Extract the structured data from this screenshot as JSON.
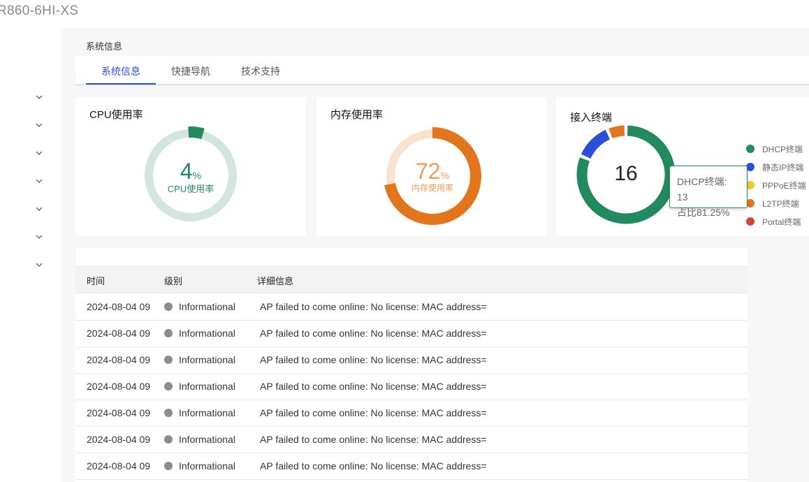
{
  "header": {
    "title": "R860-6HI-XS"
  },
  "sidebar": {
    "collapsed_items": 7
  },
  "breadcrumb": "系统信息",
  "tabs": [
    {
      "label": "系统信息",
      "active": true
    },
    {
      "label": "快捷导航"
    },
    {
      "label": "技术支持"
    }
  ],
  "cpu": {
    "title": "CPU使用率",
    "value": "4",
    "unit": "%",
    "label": "CPU使用率",
    "percent": 4,
    "color": "#23895e",
    "track": "#d3e6dd"
  },
  "memory": {
    "title": "内存使用率",
    "value": "72",
    "unit": "%",
    "label": "内存使用率",
    "percent": 72,
    "color": "#e3761c",
    "track": "#f8e2d1",
    "text_color": "#f59a56"
  },
  "terminals": {
    "title": "接入终端",
    "total": "16",
    "items": [
      {
        "name": "DHCP终端",
        "value": 13,
        "color": "#23895e"
      },
      {
        "name": "静态IP终端",
        "value": 2,
        "color": "#2b4fd8"
      },
      {
        "name": "PPPoE终端",
        "value": 0,
        "color": "#f2c931"
      },
      {
        "name": "L2TP终端",
        "value": 1,
        "color": "#e3761c"
      },
      {
        "name": "Portal终端",
        "value": 0,
        "color": "#d0453e"
      }
    ],
    "tooltip": {
      "line1": "DHCP终端: 13",
      "line2": "占比81.25%"
    }
  },
  "log_table": {
    "columns": [
      "时间",
      "级别",
      "详细信息"
    ],
    "rows": [
      {
        "time": "2024-08-04 09",
        "level": "Informational",
        "detail": "AP failed to come online: No license: MAC address="
      },
      {
        "time": "2024-08-04 09",
        "level": "Informational",
        "detail": "AP failed to come online: No license: MAC address="
      },
      {
        "time": "2024-08-04 09",
        "level": "Informational",
        "detail": "AP failed to come online: No license: MAC address="
      },
      {
        "time": "2024-08-04 09",
        "level": "Informational",
        "detail": "AP failed to come online: No license: MAC address="
      },
      {
        "time": "2024-08-04 09",
        "level": "Informational",
        "detail": "AP failed to come online: No license: MAC address="
      },
      {
        "time": "2024-08-04 09",
        "level": "Informational",
        "detail": "AP failed to come online: No license: MAC address="
      },
      {
        "time": "2024-08-04 09",
        "level": "Informational",
        "detail": "AP failed to come online: No license: MAC address="
      }
    ]
  }
}
